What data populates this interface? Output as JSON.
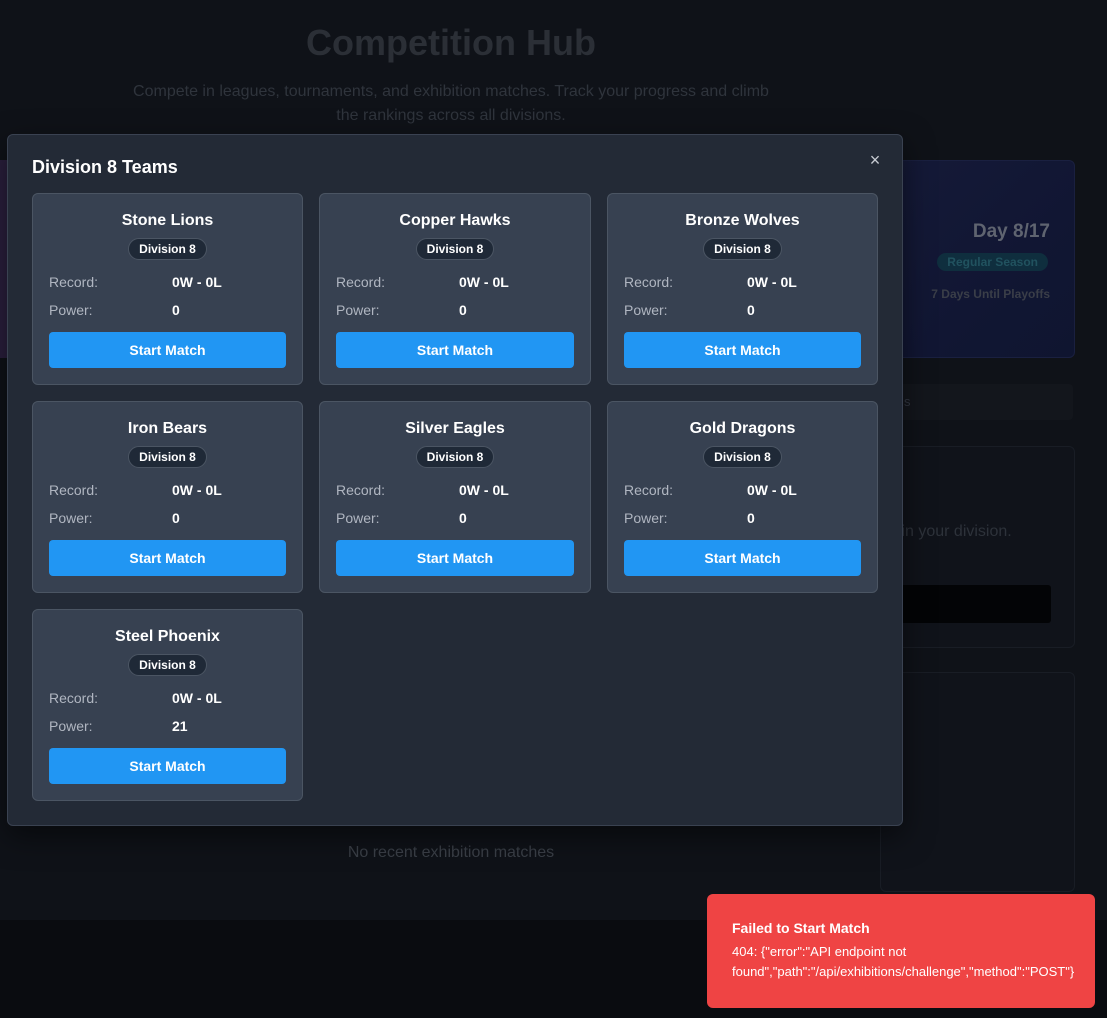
{
  "background": {
    "title": "Competition Hub",
    "subtitle": "Compete in leagues, tournaments, and exhibition matches. Track your progress and climb the rankings across all divisions.",
    "season": {
      "day": "Day 8/17",
      "phase": "Regular Season",
      "until": "7 Days Until Playoffs"
    },
    "tab_fragment": "s",
    "panel_text_fragment": "s in your division.",
    "empty_exhibitions": "No recent exhibition matches"
  },
  "modal": {
    "title": "Division 8 Teams",
    "close_label": "×",
    "record_label": "Record:",
    "power_label": "Power:",
    "button_label": "Start Match",
    "teams": [
      {
        "name": "Stone Lions",
        "division": "Division 8",
        "record": "0W - 0L",
        "power": "0"
      },
      {
        "name": "Copper Hawks",
        "division": "Division 8",
        "record": "0W - 0L",
        "power": "0"
      },
      {
        "name": "Bronze Wolves",
        "division": "Division 8",
        "record": "0W - 0L",
        "power": "0"
      },
      {
        "name": "Iron Bears",
        "division": "Division 8",
        "record": "0W - 0L",
        "power": "0"
      },
      {
        "name": "Silver Eagles",
        "division": "Division 8",
        "record": "0W - 0L",
        "power": "0"
      },
      {
        "name": "Gold Dragons",
        "division": "Division 8",
        "record": "0W - 0L",
        "power": "0"
      },
      {
        "name": "Steel Phoenix",
        "division": "Division 8",
        "record": "0W - 0L",
        "power": "21"
      }
    ]
  },
  "toast": {
    "title": "Failed to Start Match",
    "message": "404: {\"error\":\"API endpoint not\nfound\",\"path\":\"/api/exhibitions/challenge\",\"method\":\"POST\"}"
  },
  "colors": {
    "accent": "#2196f3",
    "error": "#ef4444",
    "modal_bg": "#232a36",
    "card_bg": "#374151"
  }
}
